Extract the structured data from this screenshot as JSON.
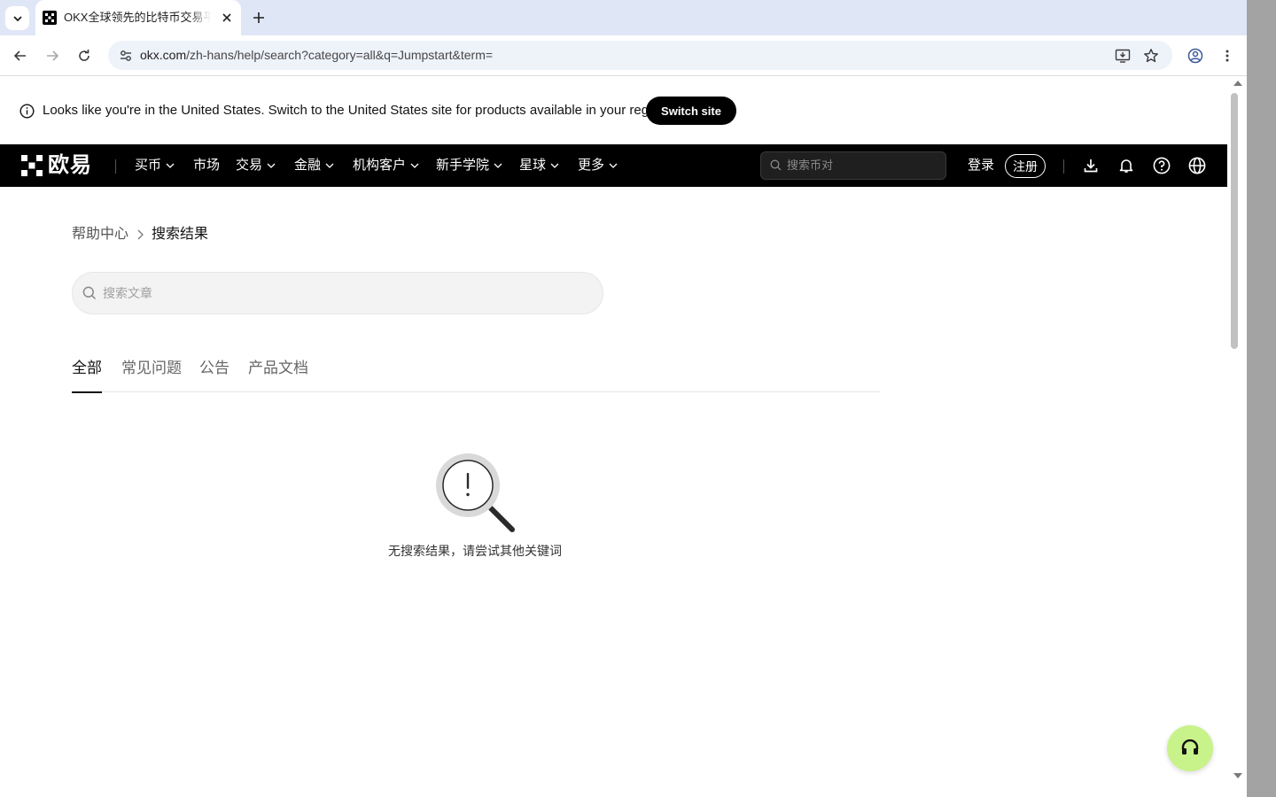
{
  "browser": {
    "tab": {
      "title": "OKX全球领先的比特币交易平台"
    },
    "url": {
      "host": "okx.com",
      "path": "/zh-hans/help/search?category=all&q=Jumpstart&term="
    }
  },
  "banner": {
    "message": "Looks like you're in the United States. Switch to the United States site for products available in your region.",
    "switch_label": "Switch site"
  },
  "nav": {
    "logo_text": "欧易",
    "items": [
      {
        "label": "买币",
        "has_dropdown": true
      },
      {
        "label": "市场",
        "has_dropdown": false
      },
      {
        "label": "交易",
        "has_dropdown": true
      },
      {
        "label": "金融",
        "has_dropdown": true
      },
      {
        "label": "机构客户",
        "has_dropdown": true
      },
      {
        "label": "新手学院",
        "has_dropdown": true
      },
      {
        "label": "星球",
        "has_dropdown": true
      },
      {
        "label": "更多",
        "has_dropdown": true
      }
    ],
    "search_placeholder": "搜索币对",
    "login_label": "登录",
    "register_label": "注册"
  },
  "breadcrumb": {
    "home": "帮助中心",
    "current": "搜索结果"
  },
  "article_search": {
    "placeholder": "搜索文章",
    "value": ""
  },
  "tabs": [
    {
      "label": "全部",
      "active": true
    },
    {
      "label": "常见问题",
      "active": false
    },
    {
      "label": "公告",
      "active": false
    },
    {
      "label": "产品文档",
      "active": false
    }
  ],
  "empty_state": {
    "message": "无搜索结果，请尝试其他关键词"
  },
  "colors": {
    "nav_bg": "#000000",
    "support_button": "#c8f28a",
    "tab_strip": "#dfe7f7"
  }
}
